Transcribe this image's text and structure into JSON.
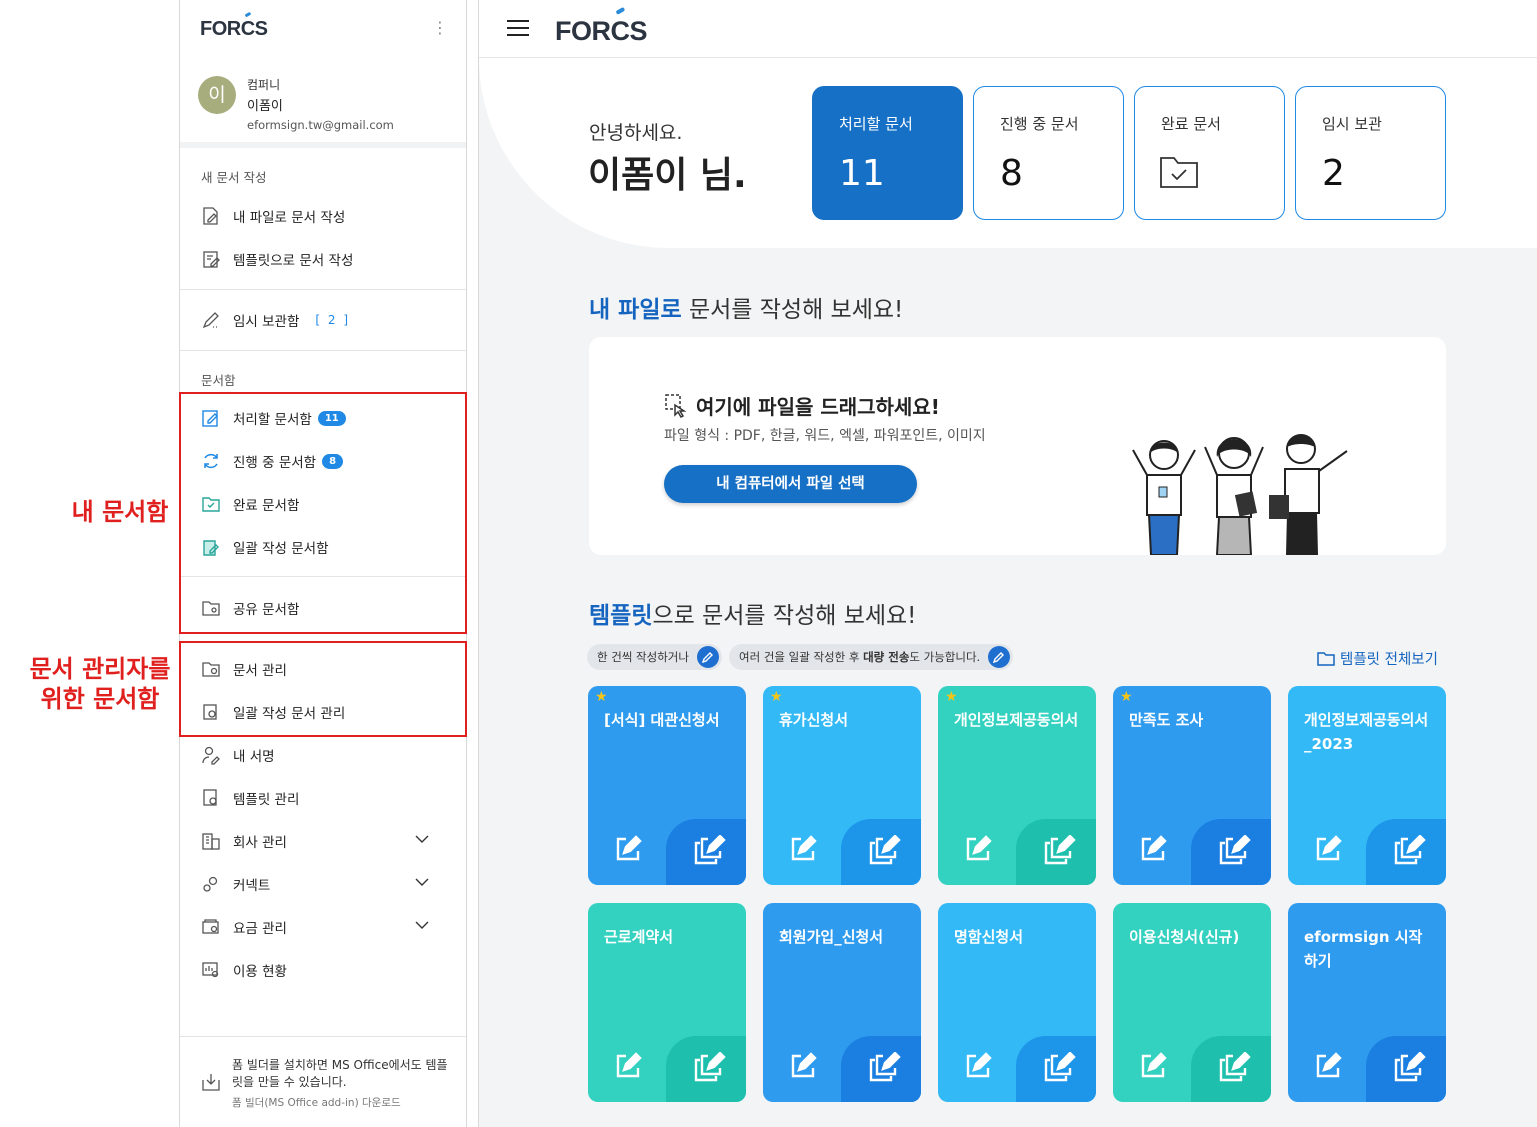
{
  "annotations": {
    "my_box": "내 문서함",
    "admin_box_line1": "문서 관리자를",
    "admin_box_line2": "위한 문서함"
  },
  "sidebar": {
    "logo": "FORCS",
    "profile": {
      "avatar": "이",
      "company": "컴퍼니",
      "name": "이폼이",
      "email": "eformsign.tw@gmail.com"
    },
    "new_doc_title": "새 문서 작성",
    "new_doc_items": [
      {
        "label": "내 파일로 문서 작성",
        "icon": "file-edit-icon"
      },
      {
        "label": "템플릿으로 문서 작성",
        "icon": "template-edit-icon"
      }
    ],
    "draft": {
      "label": "임시 보관함",
      "count": "[ 2 ]"
    },
    "docbox_title": "문서함",
    "docbox_items": [
      {
        "label": "처리할 문서함",
        "badge": "11"
      },
      {
        "label": "진행 중 문서함",
        "badge": "8"
      },
      {
        "label": "완료 문서함"
      },
      {
        "label": "일괄 작성 문서함"
      },
      {
        "label": "공유 문서함"
      }
    ],
    "admin_items": [
      {
        "label": "문서 관리"
      },
      {
        "label": "일괄 작성 문서 관리"
      }
    ],
    "other_items": [
      {
        "label": "내 서명"
      },
      {
        "label": "템플릿 관리"
      },
      {
        "label": "회사 관리"
      },
      {
        "label": "커넥트"
      },
      {
        "label": "요금 관리"
      },
      {
        "label": "이용 현황"
      }
    ],
    "bottom": {
      "text": "폼 빌더를 설치하면 MS Office에서도 템플릿을 만들 수 있습니다.",
      "link": "폼 빌더(MS Office add-in) 다운로드"
    }
  },
  "main": {
    "logo": "FORCS",
    "greeting": "안녕하세요.",
    "user_name": "이폼이 님.",
    "cards": [
      {
        "label": "처리할 문서",
        "value": "11"
      },
      {
        "label": "진행 중 문서",
        "value": "8"
      },
      {
        "label": "완료 문서",
        "icon": "folder-check-icon"
      },
      {
        "label": "임시 보관",
        "value": "2"
      }
    ],
    "upload_section": {
      "highlight": "내 파일로",
      "rest": " 문서를 작성해 보세요!"
    },
    "upload": {
      "title": "여기에 파일을 드래그하세요!",
      "formats": "파일 형식 : PDF, 한글, 워드, 엑셀, 파워포인트, 이미지",
      "button": "내 컴퓨터에서 파일 선택"
    },
    "template_section": {
      "highlight": "템플릿",
      "rest": "으로 문서를 작성해 보세요!"
    },
    "pill_single": "한 건씩 작성하거나",
    "pill_bulk_pre": "여러 건을 일괄 작성한 후 ",
    "pill_bulk_bold": "대량 전송",
    "pill_bulk_post": "도 가능합니다.",
    "view_all": "템플릿 전체보기",
    "templates": [
      {
        "title": "[서식] 대관신청서",
        "star": true,
        "color": "blue"
      },
      {
        "title": "휴가신청서",
        "star": true,
        "color": "sky"
      },
      {
        "title": "개인정보제공동의서",
        "star": true,
        "color": "teal"
      },
      {
        "title": "만족도 조사",
        "star": true,
        "color": "blue"
      },
      {
        "title": "개인정보제공동의서_2023",
        "star": false,
        "color": "sky"
      },
      {
        "title": "근로계약서",
        "star": false,
        "color": "teal"
      },
      {
        "title": "회원가입_신청서",
        "star": false,
        "color": "blue"
      },
      {
        "title": "명함신청서",
        "star": false,
        "color": "sky"
      },
      {
        "title": "이용신청서(신규)",
        "star": false,
        "color": "teal"
      },
      {
        "title": "eformsign 시작하기",
        "star": false,
        "color": "blue"
      }
    ]
  }
}
